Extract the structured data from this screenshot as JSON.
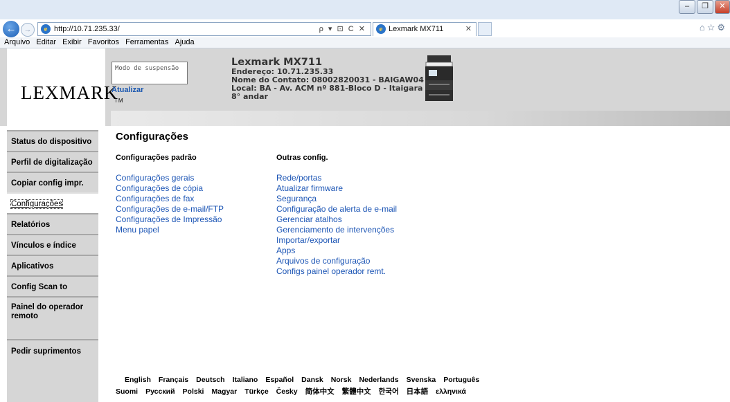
{
  "browser": {
    "url": "http://10.71.235.33/",
    "address_tools": "ρ ▾ ⊡ C ✕",
    "tab_label": "Lexmark MX711",
    "menu": [
      "Arquivo",
      "Editar",
      "Exibir",
      "Favoritos",
      "Ferramentas",
      "Ajuda"
    ]
  },
  "header": {
    "logo_text": "LEXMARK",
    "logo_tm": "TM",
    "status_text": "Modo de suspensão",
    "refresh_label": "Atualizar",
    "printer_name": "Lexmark MX711",
    "address_line": "Endereço: 10.71.235.33",
    "contact_line": "Nome do Contato: 08002820031 - BAIGAW04",
    "location_line1": "Local: BA - Av. ACM nº 881-Bloco D - Itaigara -",
    "location_line2": "8° andar"
  },
  "sidebar": {
    "items": [
      {
        "label": "Status do dispositivo"
      },
      {
        "label": "Perfil de digitalização"
      },
      {
        "label": "Copiar config impr."
      },
      {
        "label": "Configurações"
      },
      {
        "label": "Relatórios"
      },
      {
        "label": "Vínculos e índice"
      },
      {
        "label": "Aplicativos"
      },
      {
        "label": "Config Scan to Network"
      },
      {
        "label": "Painel do operador remoto"
      },
      {
        "label": "Pedir suprimentos"
      }
    ],
    "active_index": 3
  },
  "main": {
    "title": "Configurações",
    "col1_heading": "Configurações padrão",
    "col1_links": [
      "Configurações gerais",
      "Configurações de cópia",
      "Configurações de fax",
      "Configurações de e-mail/FTP",
      "Configurações de Impressão",
      "Menu papel"
    ],
    "col2_heading": "Outras config.",
    "col2_links": [
      "Rede/portas",
      "Atualizar firmware",
      "Segurança",
      "Configuração de alerta de e-mail",
      "Gerenciar atalhos",
      "Gerenciamento de intervenções",
      "Importar/exportar",
      "Apps",
      "Arquivos de configuração",
      "Configs painel operador remt."
    ]
  },
  "languages": {
    "row1": [
      "English",
      "Français",
      "Deutsch",
      "Italiano",
      "Español",
      "Dansk",
      "Norsk",
      "Nederlands",
      "Svenska",
      "Português"
    ],
    "row2": [
      "Suomi",
      "Русский",
      "Polski",
      "Magyar",
      "Türkçe",
      "Česky",
      "简体中文",
      "繁體中文",
      "한국어",
      "日本語",
      "ελληνικά"
    ]
  }
}
